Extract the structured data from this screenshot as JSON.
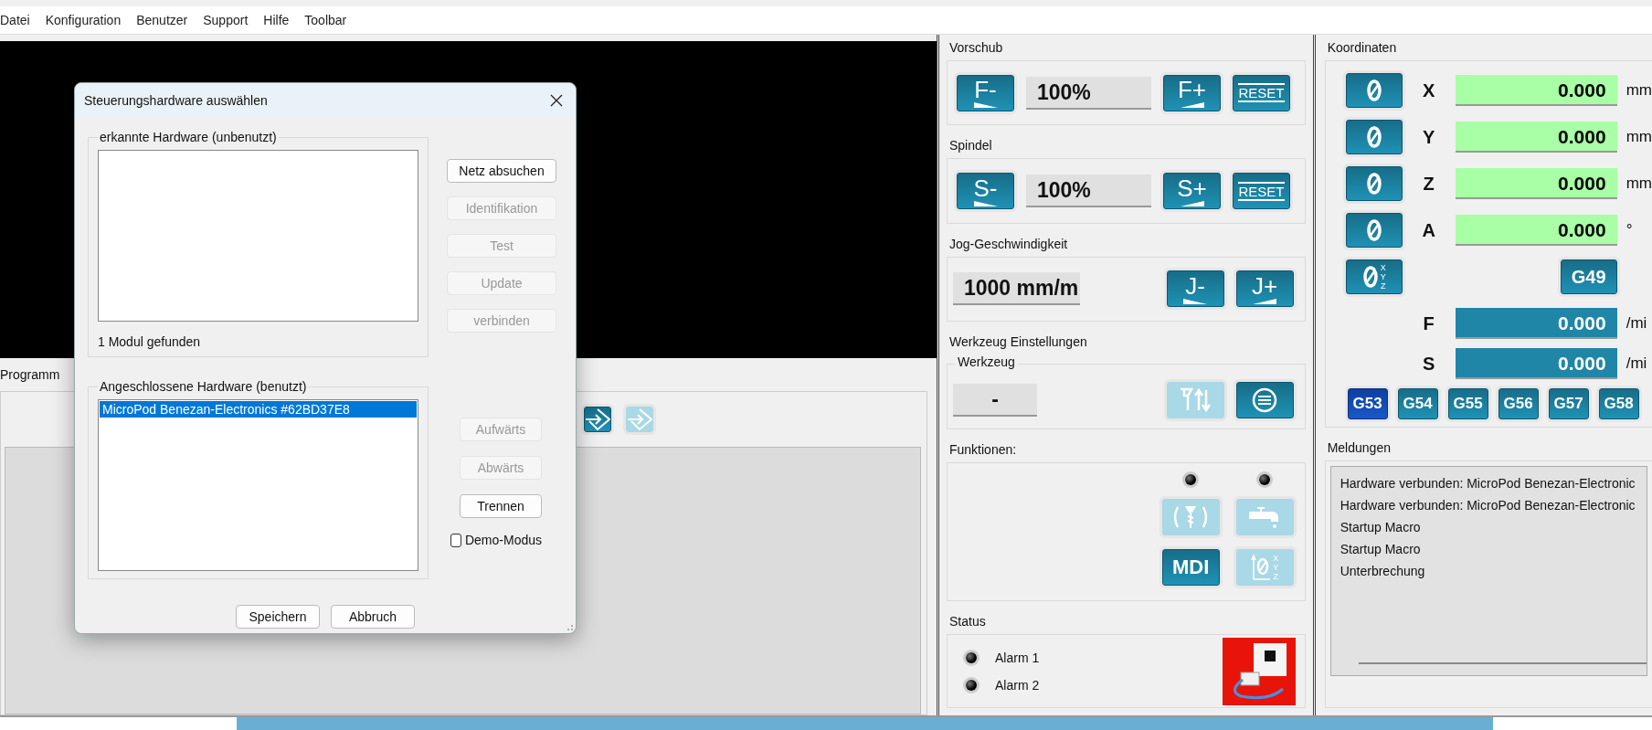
{
  "menu": [
    {
      "label": "Datei"
    },
    {
      "label": "Konfiguration"
    },
    {
      "label": "Benutzer"
    },
    {
      "label": "Support"
    },
    {
      "label": "Hilfe"
    },
    {
      "label": "Toolbar"
    }
  ],
  "program": {
    "title": "Programm",
    "toolbar": [
      {
        "disabled": false
      },
      {
        "disabled": true
      }
    ]
  },
  "feed": {
    "title": "Vorschub",
    "display": "100%",
    "minus": "F-",
    "plus": "F+",
    "reset": "RESET"
  },
  "spindle": {
    "title": "Spindel",
    "display": "100%",
    "minus": "S-",
    "plus": "S+",
    "reset": "RESET"
  },
  "jog": {
    "title": "Jog-Geschwindigkeit",
    "display": "1000 mm/m",
    "minus": "J-",
    "plus": "J+"
  },
  "tool": {
    "title": "Werkzeug Einstellungen",
    "group": "Werkzeug",
    "display": "-",
    "buttons": [
      {
        "kind": "tool-change",
        "disabled": true
      },
      {
        "kind": "tool-table",
        "disabled": false
      }
    ]
  },
  "functions": {
    "title": "Funktionen:",
    "leds": [
      {
        "on": false
      },
      {
        "on": false
      }
    ],
    "buttons": [
      {
        "kind": "spindle",
        "disabled": true
      },
      {
        "kind": "coolant",
        "disabled": true
      },
      {
        "kind": "mdi",
        "label": "MDI",
        "disabled": false
      },
      {
        "kind": "zero-all",
        "letters": [
          "X",
          "Y",
          "Z"
        ],
        "disabled": true
      }
    ]
  },
  "status": {
    "title": "Status",
    "alarms": [
      {
        "label": "Alarm 1",
        "on": false
      },
      {
        "label": "Alarm 2",
        "on": false
      }
    ]
  },
  "coordinates": {
    "title": "Koordinaten",
    "axes": [
      {
        "axis": "X",
        "value": "0.000",
        "unit": "mm"
      },
      {
        "axis": "Y",
        "value": "0.000",
        "unit": "mm"
      },
      {
        "axis": "Z",
        "value": "0.000",
        "unit": "mm"
      },
      {
        "axis": "A",
        "value": "0.000",
        "unit": "°"
      }
    ],
    "zero_all_letters": [
      "X",
      "Y",
      "Z"
    ],
    "tool_offset": "G49",
    "rates": [
      {
        "axis": "F",
        "value": "0.000",
        "unit": "/mi"
      },
      {
        "axis": "S",
        "value": "0.000",
        "unit": "/mi"
      }
    ],
    "work_offsets": [
      {
        "label": "G53",
        "selected": true
      },
      {
        "label": "G54",
        "selected": false
      },
      {
        "label": "G55",
        "selected": false
      },
      {
        "label": "G56",
        "selected": false
      },
      {
        "label": "G57",
        "selected": false
      },
      {
        "label": "G58",
        "selected": false
      }
    ]
  },
  "messages": {
    "title": "Meldungen",
    "lines": [
      "Hardware verbunden: MicroPod Benezan-Electronic",
      "Hardware verbunden: MicroPod Benezan-Electronic",
      "Startup Macro",
      "Startup Macro",
      "Unterbrechung"
    ]
  },
  "dialog": {
    "title": "Steuerungshardware auswählen",
    "detected": {
      "title": "erkannte Hardware (unbenutzt)",
      "status": "1 Modul gefunden"
    },
    "detected_buttons": [
      {
        "label": "Netz absuchen",
        "disabled": false
      },
      {
        "label": "Identifikation",
        "disabled": true
      },
      {
        "label": "Test",
        "disabled": true
      },
      {
        "label": "Update",
        "disabled": true
      },
      {
        "label": "verbinden",
        "disabled": true
      }
    ],
    "connected": {
      "title": "Angeschlossene Hardware (benutzt)",
      "items": [
        {
          "label": "MicroPod Benezan-Electronics #62BD37E8",
          "selected": true
        }
      ]
    },
    "connected_buttons": [
      {
        "label": "Aufwärts",
        "disabled": true
      },
      {
        "label": "Abwärts",
        "disabled": true
      },
      {
        "label": "Trennen",
        "disabled": false
      }
    ],
    "demo_mode": {
      "label": "Demo-Modus",
      "checked": false
    },
    "footer_buttons": [
      {
        "label": "Speichern"
      },
      {
        "label": "Abbruch"
      }
    ]
  }
}
